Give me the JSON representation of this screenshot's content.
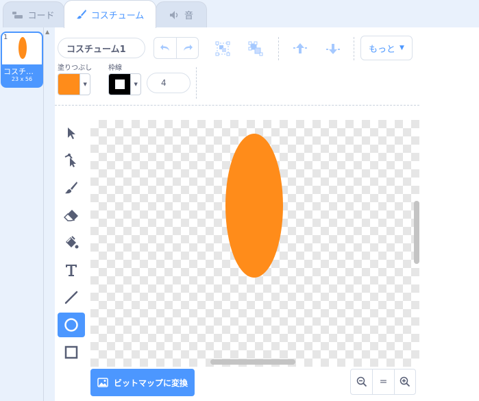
{
  "tabs": [
    {
      "label": "コード",
      "icon": "code-icon"
    },
    {
      "label": "コスチューム",
      "icon": "brush-icon"
    },
    {
      "label": "音",
      "icon": "speaker-icon"
    }
  ],
  "active_tab": "コスチューム",
  "costumes": [
    {
      "number": "1",
      "name": "コスチューム1",
      "size": "23 x 56"
    }
  ],
  "costume_name_value": "コスチューム1",
  "more_button": "もっと",
  "fill_label": "塗りつぶし",
  "outline_label": "枠線",
  "outline_width": "4",
  "convert_button": "ビットマップに変換",
  "zoom": {
    "zoom_out": "−",
    "reset": "=",
    "zoom_in": "+"
  },
  "colors": {
    "accent": "#4c97ff",
    "fill_color": "#ff8c1a",
    "outline_color": "#000000",
    "shape_color": "#ff8c1a"
  },
  "tools": [
    "select",
    "reshape",
    "brush",
    "eraser",
    "fill",
    "text",
    "line",
    "circle",
    "rectangle"
  ],
  "active_tool": "circle"
}
